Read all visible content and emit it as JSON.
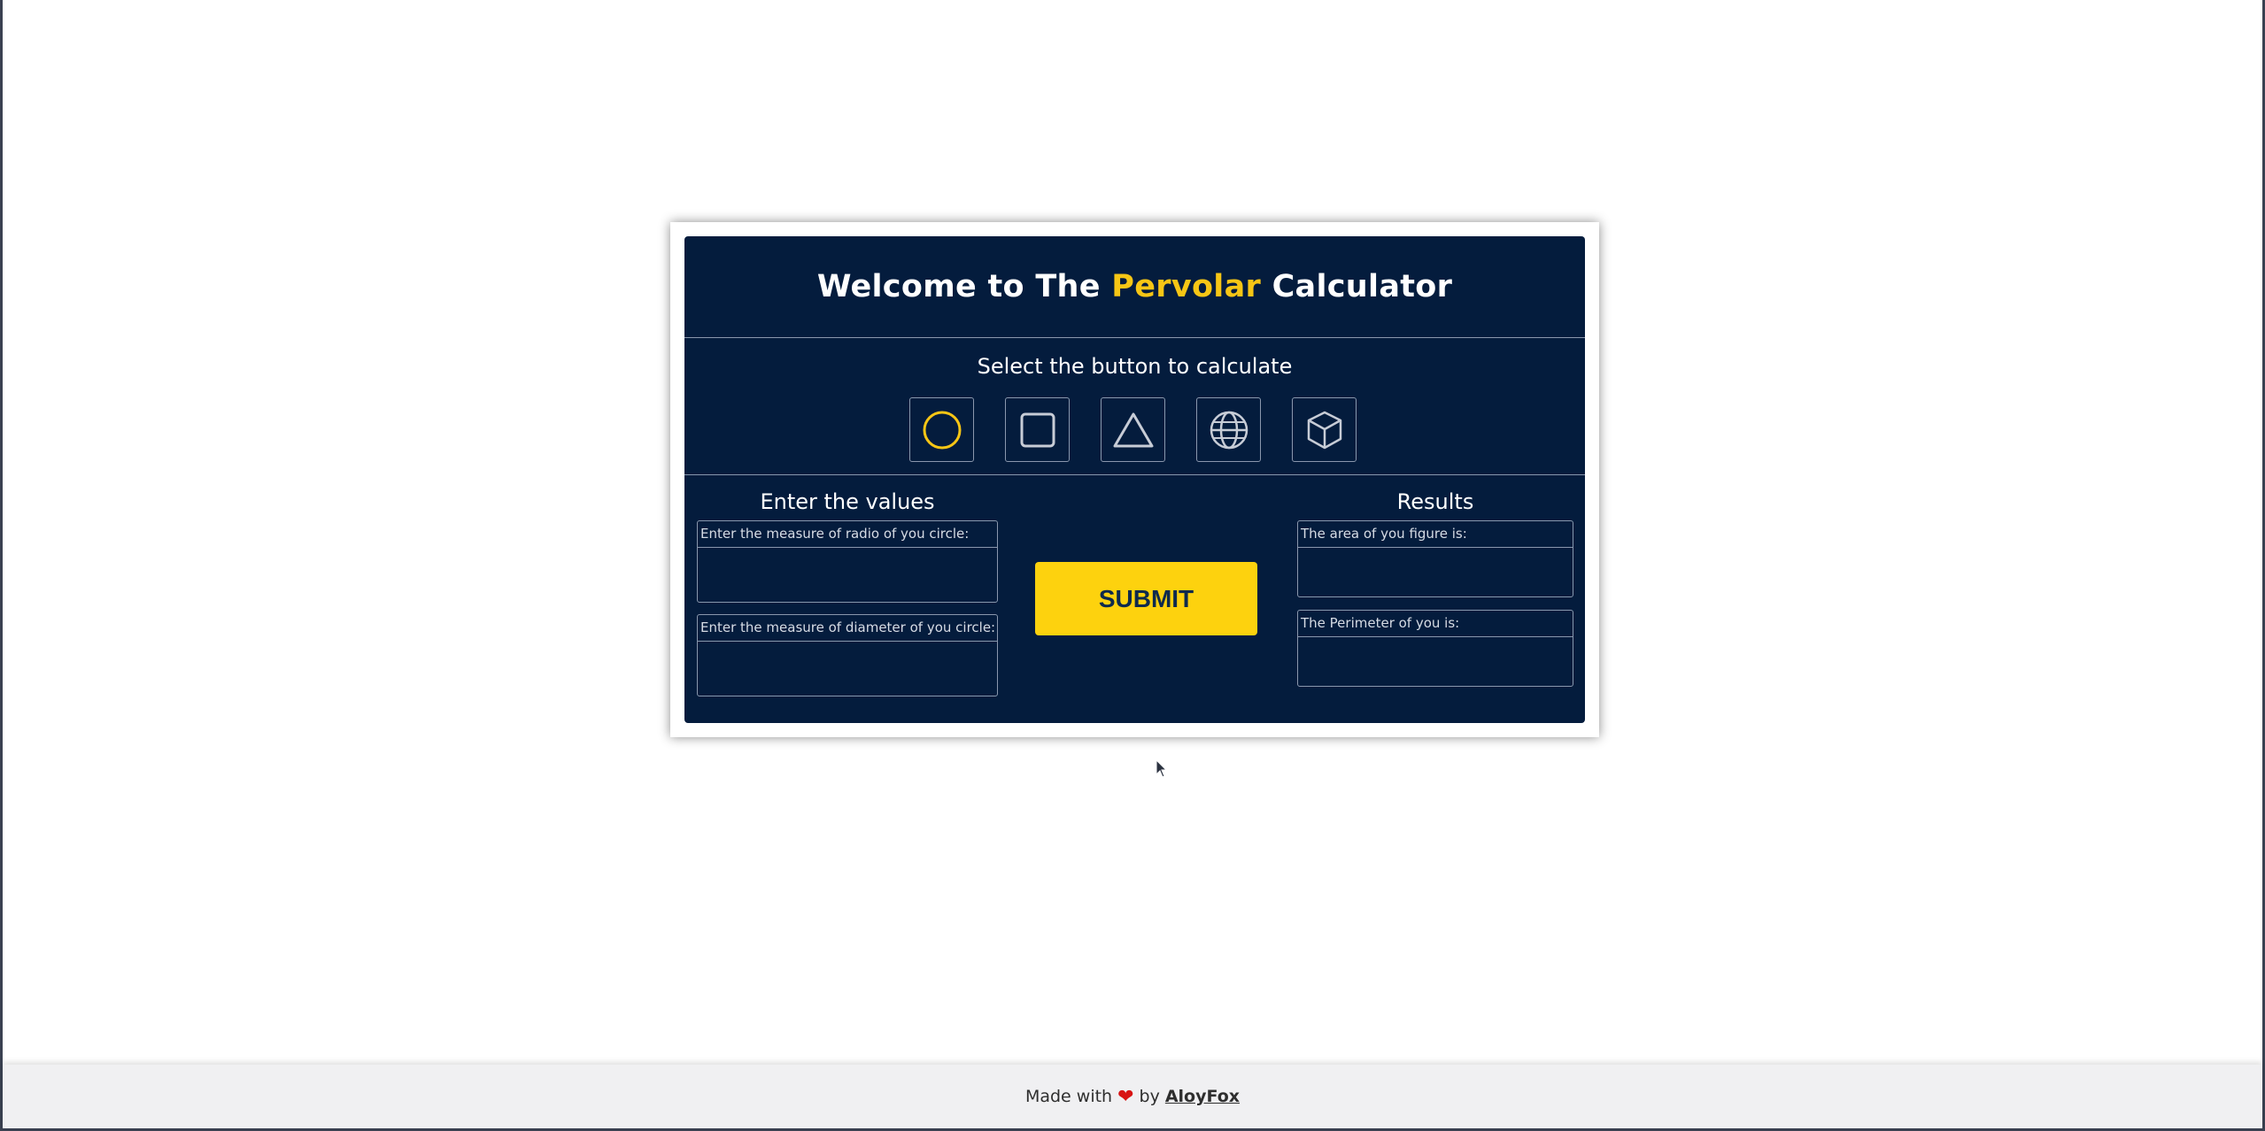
{
  "header": {
    "title_prefix": "Welcome to The ",
    "title_brand": "Pervolar",
    "title_suffix": " Calculator"
  },
  "selector": {
    "prompt": "Select the button to calculate",
    "buttons": [
      {
        "icon": "circle-icon",
        "selected": true
      },
      {
        "icon": "square-icon",
        "selected": false
      },
      {
        "icon": "triangle-icon",
        "selected": false
      },
      {
        "icon": "sphere-icon",
        "selected": false
      },
      {
        "icon": "cube-icon",
        "selected": false
      }
    ]
  },
  "inputs": {
    "heading": "Enter the values",
    "fields": [
      {
        "label": "Enter the measure of radio of you circle:",
        "value": ""
      },
      {
        "label": "Enter the measure of diameter of you circle:",
        "value": ""
      }
    ]
  },
  "submit": {
    "label": "SUBMIT"
  },
  "results": {
    "heading": "Results",
    "fields": [
      {
        "label": "The area of you figure is:",
        "value": ""
      },
      {
        "label": "The Perimeter of you is:",
        "value": ""
      }
    ]
  },
  "footer": {
    "made_with": "Made with",
    "by": "by",
    "author": "AloyFox"
  },
  "colors": {
    "card_bg": "#041c3d",
    "accent": "#f7c615",
    "submit_bg": "#fdd20e",
    "border": "#8a97ad",
    "heart": "#d81414"
  }
}
